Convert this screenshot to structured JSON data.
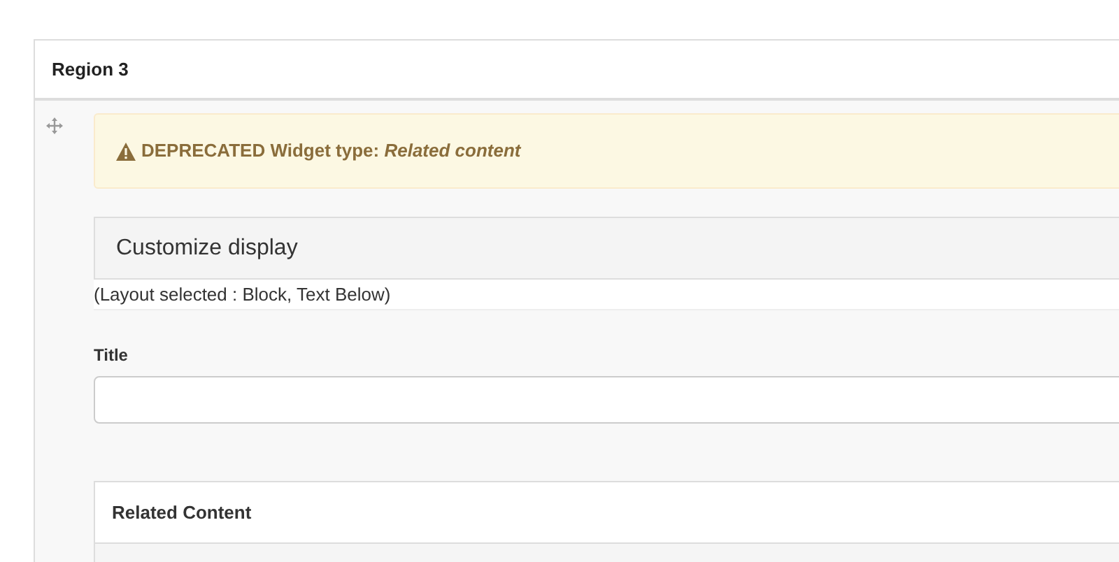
{
  "region": {
    "title": "Region 3"
  },
  "alert": {
    "text": "DEPRECATED Widget type: *Related content*"
  },
  "customize": {
    "title": "Customize display",
    "layout_note": "(Layout selected : Block, Text Below)"
  },
  "title_field": {
    "label": "Title"
  },
  "related": {
    "title": "Related Content"
  }
}
